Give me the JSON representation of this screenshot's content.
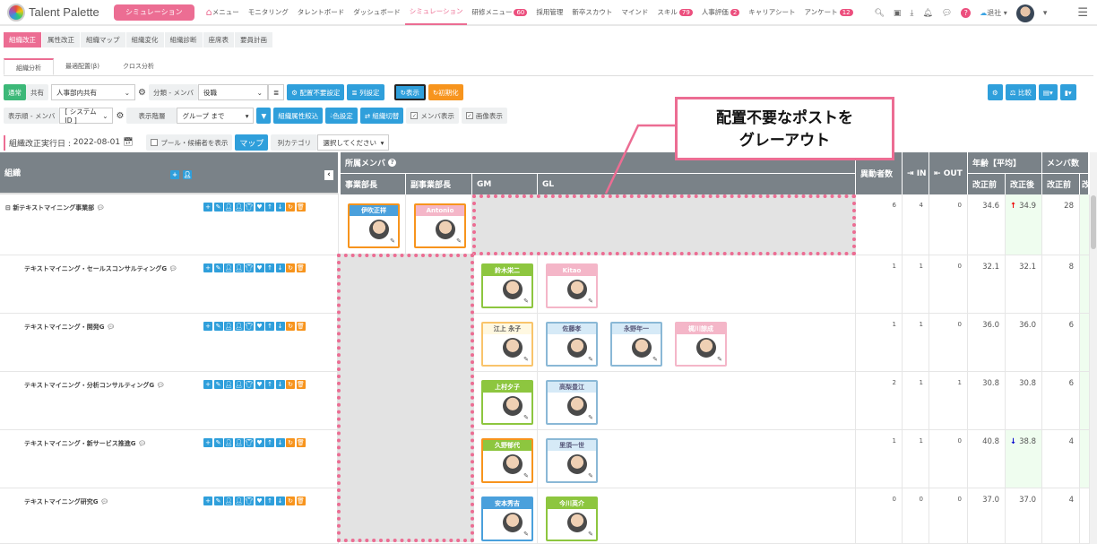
{
  "nav": {
    "brand": "Talent Palette",
    "sim_button": "シミュレーション",
    "items": [
      {
        "label": "メニュー"
      },
      {
        "label": "モニタリング"
      },
      {
        "label": "タレントボード"
      },
      {
        "label": "ダッシュボード"
      },
      {
        "label": "シミュレーション",
        "active": true
      },
      {
        "label": "研修メニュー",
        "badge": "60"
      },
      {
        "label": "採用管理"
      },
      {
        "label": "新卒スカウト"
      },
      {
        "label": "マインド"
      },
      {
        "label": "スキル",
        "badge": "79"
      },
      {
        "label": "人事評価",
        "badge": "2"
      },
      {
        "label": "キャリアシート"
      },
      {
        "label": "アンケート",
        "badge": "12"
      }
    ],
    "status": "退社"
  },
  "tabs1": [
    "組織改正",
    "属性改正",
    "組織マップ",
    "組織変化",
    "組織診断",
    "座席表",
    "要員計画"
  ],
  "tabs2": [
    "組織分析",
    "最適配置(β)",
    "クロス分析"
  ],
  "toolbar1": {
    "normal": "通常",
    "shared": "共有",
    "share_select": "人事部内共有",
    "classify_label": "分類 - メンバ",
    "classify_value": "役職",
    "no_place": "配置不要設定",
    "columns": "列設定",
    "show": "表示",
    "reset": "初期化",
    "compare": "比較"
  },
  "toolbar2": {
    "order_label": "表示順 - メンバ",
    "order_value": "[ システムID ]",
    "level_label": "表示階層",
    "level_value": "グループ まで",
    "attr_filter": "組織属性絞込",
    "color": "色設定",
    "switch": "組織切替",
    "show_members": "メンバ表示",
    "show_images": "画像表示"
  },
  "toolbar3": {
    "date_label": "組織改正実行日 :",
    "date": "2022-08-01",
    "pool": "プール・候補者を表示",
    "map": "マップ",
    "col_cat": "列カテゴリ",
    "col_cat_value": "選択してください"
  },
  "callout": {
    "line1": "配置不要なポストを",
    "line2": "グレーアウト"
  },
  "table": {
    "org": "組織",
    "members": "所属メンバ",
    "positions": [
      "事業部長",
      "副事業部長",
      "GM",
      "GL"
    ],
    "moves": "異動者数",
    "in": "IN",
    "out": "OUT",
    "age": "年齢【平均】",
    "count": "メンバ数",
    "before": "改正前",
    "after": "改正後",
    "after_short": "改"
  },
  "rows": [
    {
      "org": "新テキストマイニング事業部",
      "top": true,
      "jigyo": [
        {
          "name": "伊吹正祥",
          "style": "blue",
          "sel": true
        }
      ],
      "fuku": [
        {
          "name": "Antonio",
          "style": "pink",
          "sel": true
        }
      ],
      "gm": [],
      "gl": [],
      "moves": "6",
      "in": "4",
      "out": "0",
      "age_before": "34.6",
      "age_after": "34.9",
      "trend": "up",
      "count_before": "28"
    },
    {
      "org": "テキストマイニング・セールスコンサルティングG",
      "jigyo": [],
      "fuku": [],
      "gm": [
        {
          "name": "鈴木栄二",
          "style": "green"
        }
      ],
      "gl": [
        {
          "name": "Kitao　Michelle",
          "style": "pink"
        }
      ],
      "moves": "1",
      "in": "1",
      "out": "0",
      "age_before": "32.1",
      "age_after": "32.1",
      "trend": "",
      "count_before": "8"
    },
    {
      "org": "テキストマイニング・開発G",
      "jigyo": [],
      "fuku": [],
      "gm": [
        {
          "name": "江上 永子",
          "style": "yellow"
        }
      ],
      "gl": [
        {
          "name": "佐藤孝",
          "style": "light"
        },
        {
          "name": "永野年一",
          "style": "light"
        },
        {
          "name": "梶川諒成",
          "style": "pink"
        }
      ],
      "moves": "1",
      "in": "1",
      "out": "0",
      "age_before": "36.0",
      "age_after": "36.0",
      "trend": "",
      "count_before": "6"
    },
    {
      "org": "テキストマイニング・分析コンサルティングG",
      "jigyo": [],
      "fuku": [],
      "gm": [
        {
          "name": "上村夕子",
          "style": "green"
        }
      ],
      "gl": [
        {
          "name": "高梨豊江",
          "style": "light"
        }
      ],
      "moves": "2",
      "in": "1",
      "out": "1",
      "age_before": "30.8",
      "age_after": "30.8",
      "trend": "",
      "count_before": "6"
    },
    {
      "org": "テキストマイニング・新サービス推進G",
      "jigyo": [],
      "fuku": [],
      "gm": [
        {
          "name": "久野郁代",
          "style": "green",
          "sel": true
        }
      ],
      "gl": [
        {
          "name": "里須一世",
          "style": "light"
        }
      ],
      "moves": "1",
      "in": "1",
      "out": "0",
      "age_before": "40.8",
      "age_after": "38.8",
      "trend": "down",
      "count_before": "4"
    },
    {
      "org": "テキストマイニング研究G",
      "jigyo": [],
      "fuku": [],
      "gm": [
        {
          "name": "安本秀吉",
          "style": "blue"
        }
      ],
      "gl": [
        {
          "name": "今川英介",
          "style": "green"
        }
      ],
      "moves": "0",
      "in": "0",
      "out": "0",
      "age_before": "37.0",
      "age_after": "37.0",
      "trend": "",
      "count_before": "4"
    }
  ]
}
